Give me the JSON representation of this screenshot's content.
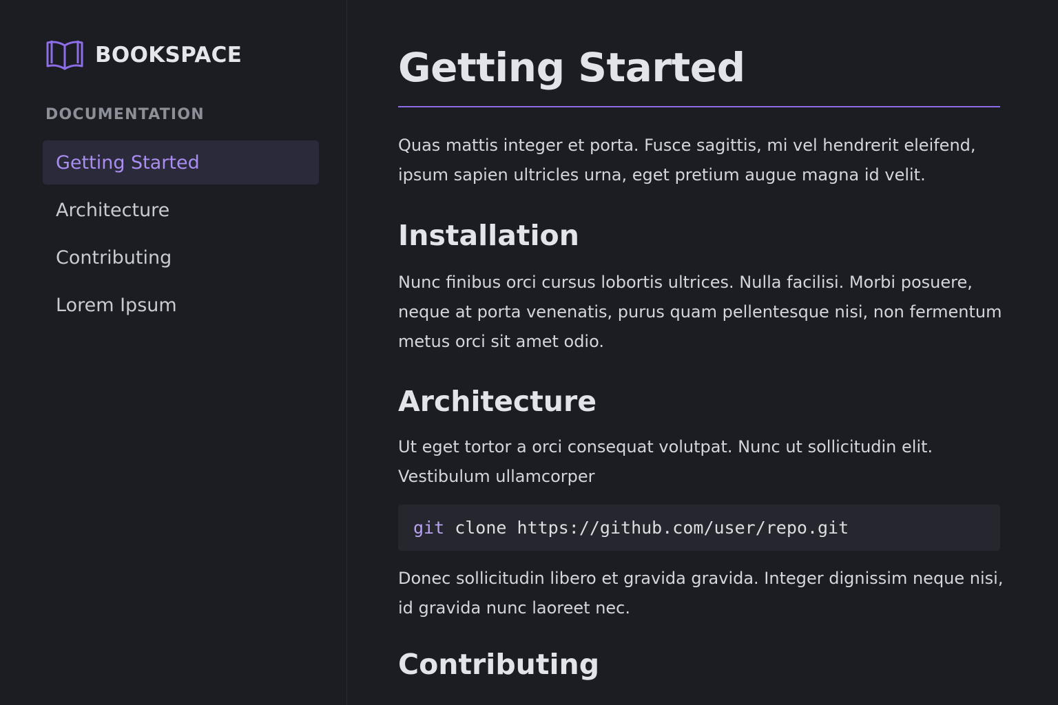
{
  "brand": {
    "name": "BOOKSPACE",
    "icon": "open-book-icon",
    "accent": "#8d6ee8"
  },
  "sidebar": {
    "section_label": "DOCUMENTATION",
    "items": [
      {
        "label": "Getting Started",
        "active": true
      },
      {
        "label": "Architecture",
        "active": false
      },
      {
        "label": "Contributing",
        "active": false
      },
      {
        "label": "Lorem Ipsum",
        "active": false
      }
    ]
  },
  "main": {
    "title": "Getting Started",
    "intro": "Quas mattis integer et porta. Fusce sagittis, mi vel hendrerit eleifend, ipsum sapien ultricles urna, eget pretium augue magna id velit.",
    "installation": {
      "heading": "Installation",
      "body": "Nunc finibus orci cursus lobortis ultrices. Nulla facilisi. Morbi posuere, neque at porta venenatis, purus quam pellentesque nisi, non fermentum metus orci sit amet odio."
    },
    "architecture": {
      "heading": "Architecture",
      "body": "Ut eget tortor a orci consequat volutpat. Nunc ut sollicitudin elit. Vestibulum ullamcorper",
      "code": {
        "keyword": "git",
        "rest": " clone https://github.com/user/repo.git"
      },
      "after": "Donec sollicitudin libero et gravida gravida. Integer dignissim neque nisi, id gravida nunc laoreet nec."
    },
    "contributing": {
      "heading": "Contributing"
    }
  },
  "colors": {
    "background": "#1c1d22",
    "accent": "#8d6ee8",
    "active_nav_bg": "#2a2a3a",
    "active_nav_text": "#a98ef0",
    "code_bg": "#26262f"
  }
}
